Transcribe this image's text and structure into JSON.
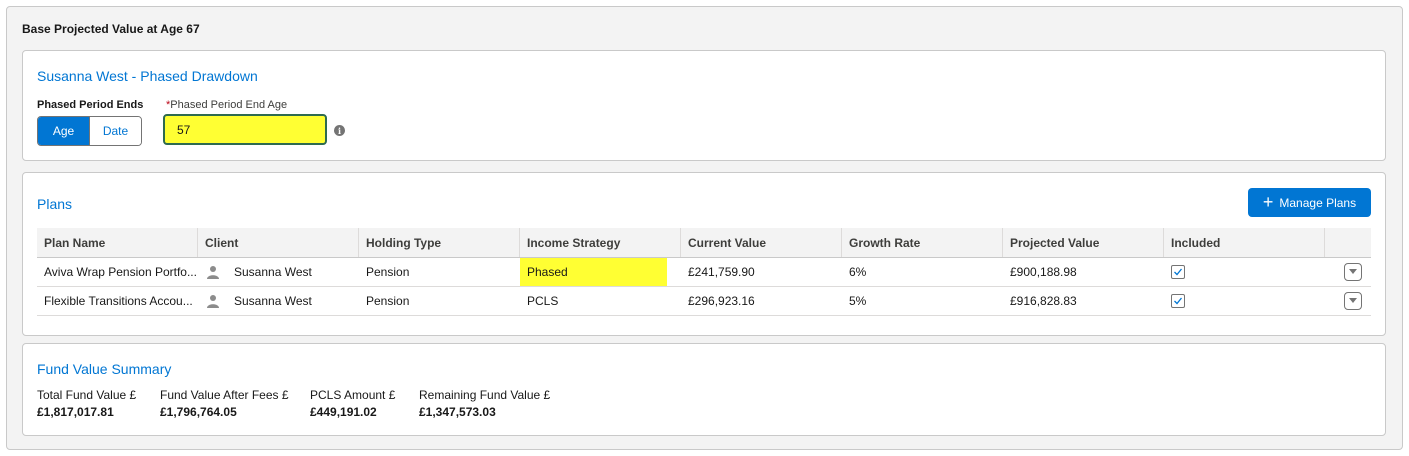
{
  "section_title": "Base Projected Value at Age 67",
  "drawdown": {
    "title": "Susanna West - Phased Drawdown",
    "period_label": "Phased Period Ends",
    "toggle": {
      "age": "Age",
      "date": "Date",
      "selected": "Age"
    },
    "end_age_label": "Phased Period End Age",
    "required_marker": "*",
    "end_age_value": "57"
  },
  "plans": {
    "title": "Plans",
    "manage_button": "Manage Plans",
    "columns": [
      "Plan Name",
      "Client",
      "Holding Type",
      "Income Strategy",
      "Current Value",
      "Growth Rate",
      "Projected Value",
      "Included"
    ],
    "rows": [
      {
        "plan_name": "Aviva Wrap Pension Portfo...",
        "client": "Susanna West",
        "holding_type": "Pension",
        "income_strategy": "Phased",
        "current_value": "£241,759.90",
        "growth_rate": "6%",
        "projected_value": "£900,188.98",
        "included": true,
        "strategy_highlight": true
      },
      {
        "plan_name": "Flexible Transitions Accou...",
        "client": "Susanna West",
        "holding_type": "Pension",
        "income_strategy": "PCLS",
        "current_value": "£296,923.16",
        "growth_rate": "5%",
        "projected_value": "£916,828.83",
        "included": true,
        "strategy_highlight": false
      }
    ]
  },
  "summary": {
    "title": "Fund Value Summary",
    "items": [
      {
        "label": "Total Fund Value £",
        "value": "£1,817,017.81"
      },
      {
        "label": "Fund Value After Fees £",
        "value": "£1,796,764.05"
      },
      {
        "label": "PCLS Amount £",
        "value": "£449,191.02"
      },
      {
        "label": "Remaining Fund Value £",
        "value": "£1,347,573.03"
      }
    ]
  },
  "colors": {
    "brand": "#0176d3",
    "highlight": "#ffff33",
    "border": "#c9c9c9"
  }
}
